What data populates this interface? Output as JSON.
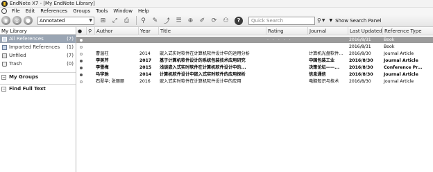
{
  "window": {
    "title": "EndNote X7 - [My EndNote Library]"
  },
  "menu": [
    "File",
    "Edit",
    "References",
    "Groups",
    "Tools",
    "Window",
    "Help"
  ],
  "toolbar": {
    "style_value": "Annotated",
    "search_placeholder": "Quick Search",
    "show_search_panel": "Show Search Panel",
    "icons": [
      "local-library-icon",
      "online-search-icon",
      "integrated-library-icon",
      "find-fulltext-icon",
      "open-link-icon",
      "open-pdf-icon",
      "insert-citation-icon",
      "format-bibliography-icon",
      "export-word-icon",
      "new-reference-icon",
      "edit-reference-icon",
      "sync-icon",
      "share-icon",
      "help-icon"
    ]
  },
  "left_panel": {
    "header": "My Library",
    "items": [
      {
        "label": "All References",
        "count": "(7)",
        "icon": "all-references-icon"
      },
      {
        "label": "Imported References",
        "count": "(1)",
        "icon": "imported-references-icon"
      },
      {
        "label": "Unfiled",
        "count": "(7)",
        "icon": "unfiled-icon"
      },
      {
        "label": "Trash",
        "count": "(0)",
        "icon": "trash-icon"
      }
    ],
    "groups": [
      {
        "label": "My Groups"
      },
      {
        "label": "Find Full Text"
      }
    ]
  },
  "table": {
    "headers": {
      "author": "Author",
      "year": "Year",
      "title": "Title",
      "rating": "Rating",
      "journal": "Journal",
      "updated": "Last Updated",
      "type": "Reference Type"
    },
    "rows": [
      {
        "author": "",
        "year": "",
        "title": "",
        "rating": "· · · · ·",
        "journal": "",
        "updated": "2016/8/31",
        "type": "Book",
        "state": "selected"
      },
      {
        "author": "",
        "year": "",
        "title": "",
        "rating": "",
        "journal": "",
        "updated": "2016/8/31",
        "type": "Book",
        "state": "read"
      },
      {
        "author": "曹温柱",
        "year": "2014",
        "title": "嵌入式实时软件在计算机软件设计中的运用分析",
        "rating": "",
        "journal": "计算机光盘软件...",
        "updated": "2016/8/30",
        "type": "Journal Article",
        "state": "read"
      },
      {
        "author": "李美芹",
        "year": "2017",
        "title": "基于计算机软件设计的系统包装技术应用研究",
        "rating": "",
        "journal": "中国包装工业",
        "updated": "2016/8/30",
        "type": "Journal Article",
        "state": "unread"
      },
      {
        "author": "李雪梅",
        "year": "2015",
        "title": "浅谈嵌入式实时软件在计算机软件设计中的...",
        "rating": "",
        "journal": "决策论坛——...",
        "updated": "2016/8/30",
        "type": "Conference Pr...",
        "state": "unread"
      },
      {
        "author": "马宇驰",
        "year": "2014",
        "title": "计算机软件设计中嵌入式实时软件的应用探析",
        "rating": "",
        "journal": "信息通信",
        "updated": "2016/8/30",
        "type": "Journal Article",
        "state": "unread"
      },
      {
        "author": "石翠华; 张丽丽",
        "year": "2016",
        "title": "嵌入式实时软件在计算机软件设计中的应用",
        "rating": "",
        "journal": "电脑知识与技术",
        "updated": "2016/8/30",
        "type": "Journal Article",
        "state": "read"
      }
    ]
  }
}
